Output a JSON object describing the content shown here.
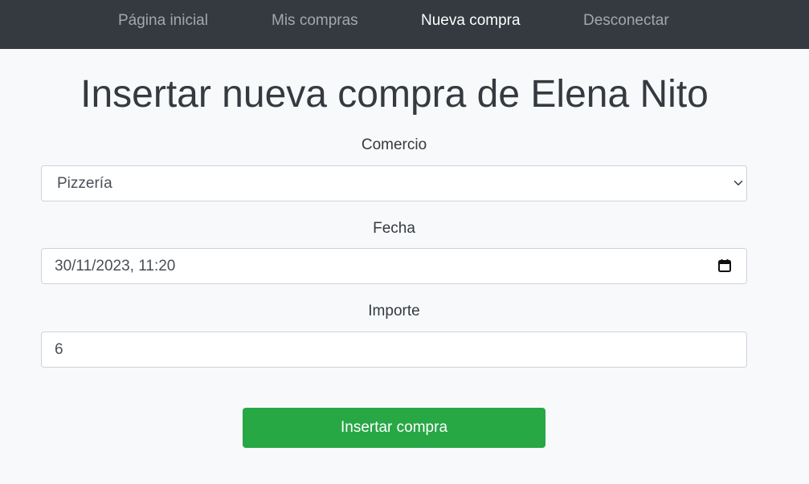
{
  "nav": {
    "items": [
      {
        "label": "Página inicial",
        "active": false
      },
      {
        "label": "Mis compras",
        "active": false
      },
      {
        "label": "Nueva compra",
        "active": true
      },
      {
        "label": "Desconectar",
        "active": false
      }
    ]
  },
  "page": {
    "title": "Insertar nueva compra de Elena Nito"
  },
  "form": {
    "comercio": {
      "label": "Comercio",
      "value": "Pizzería",
      "icon": "chevron-down-icon"
    },
    "fecha": {
      "label": "Fecha",
      "value": "30/11/2023, 11:20",
      "icon": "calendar-icon"
    },
    "importe": {
      "label": "Importe",
      "value": "6"
    },
    "submit_label": "Insertar compra"
  },
  "colors": {
    "navbar_bg": "#343a40",
    "page_bg": "#f8f9fa",
    "nav_inactive": "#9a9da0",
    "nav_active": "#ffffff",
    "button_bg": "#28a745",
    "text": "#343a40"
  }
}
